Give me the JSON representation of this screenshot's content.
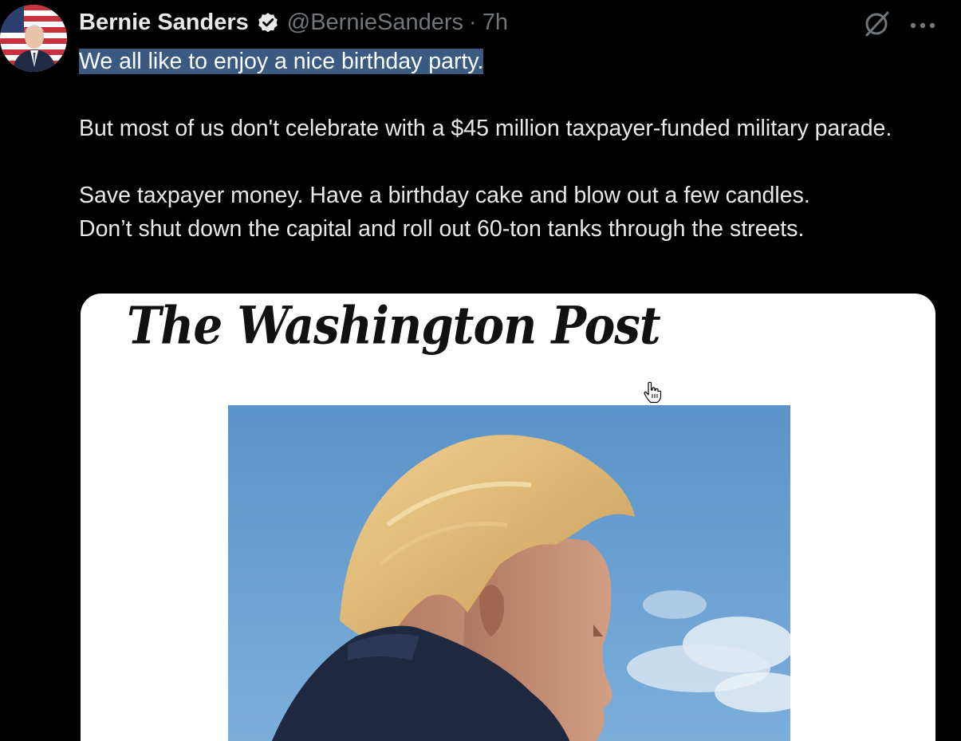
{
  "tweet": {
    "author_name": "Bernie Sanders",
    "handle": "@BernieSanders",
    "separator": "·",
    "time": "7h",
    "text": {
      "line1": "We all like to enjoy a nice birthday party.",
      "para2": "But most of us don't celebrate with a $45 million taxpayer-funded military parade.",
      "para3a": "Save taxpayer money. Have a birthday cake and blow out a few candles.",
      "para3b": "Don’t shut down the capital and roll out 60-ton tanks through the streets."
    }
  },
  "card": {
    "masthead": "The Washington Post"
  },
  "icons": {
    "verified": "verified-badge-icon",
    "grok": "grok-icon",
    "more": "more-icon",
    "cursor": "hand-cursor-icon"
  },
  "colors": {
    "background": "#000000",
    "text": "#e7e9ea",
    "muted": "#71767b",
    "selection": "#3b5a82",
    "card": "#ffffff",
    "sky": "#5a93c9"
  }
}
